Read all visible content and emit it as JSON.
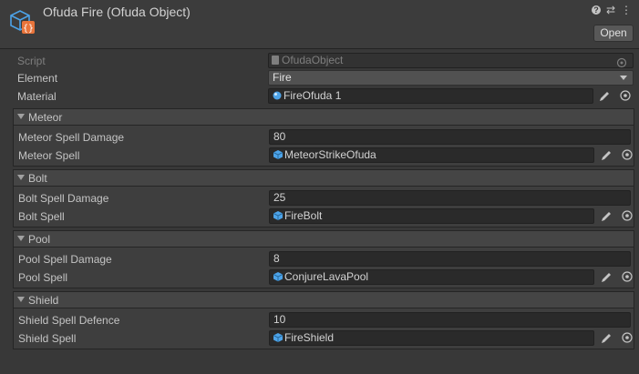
{
  "header": {
    "title": "Ofuda Fire (Ofuda Object)",
    "open_label": "Open",
    "icons": [
      "scriptable-object-icon",
      "help-icon",
      "preset-icon",
      "more-menu-icon"
    ]
  },
  "properties": {
    "script": {
      "label": "Script",
      "value": "OfudaObject"
    },
    "element": {
      "label": "Element",
      "value": "Fire"
    },
    "material": {
      "label": "Material",
      "value": "FireOfuda 1"
    }
  },
  "groups": [
    {
      "title": "Meteor",
      "value_label": "Meteor Spell Damage",
      "value": "80",
      "spell_label": "Meteor Spell",
      "spell": "MeteorStrikeOfuda"
    },
    {
      "title": "Bolt",
      "value_label": "Bolt Spell Damage",
      "value": "25",
      "spell_label": "Bolt Spell",
      "spell": "FireBolt"
    },
    {
      "title": "Pool",
      "value_label": "Pool Spell Damage",
      "value": "8",
      "spell_label": "Pool Spell",
      "spell": "ConjureLavaPool"
    },
    {
      "title": "Shield",
      "value_label": "Shield Spell Defence",
      "value": "10",
      "spell_label": "Shield Spell",
      "spell": "FireShield"
    }
  ],
  "colors": {
    "background": "#383838",
    "field": "#2a2a2a",
    "icon_accent": "#4da3e8",
    "icon_orange": "#e8743b"
  }
}
